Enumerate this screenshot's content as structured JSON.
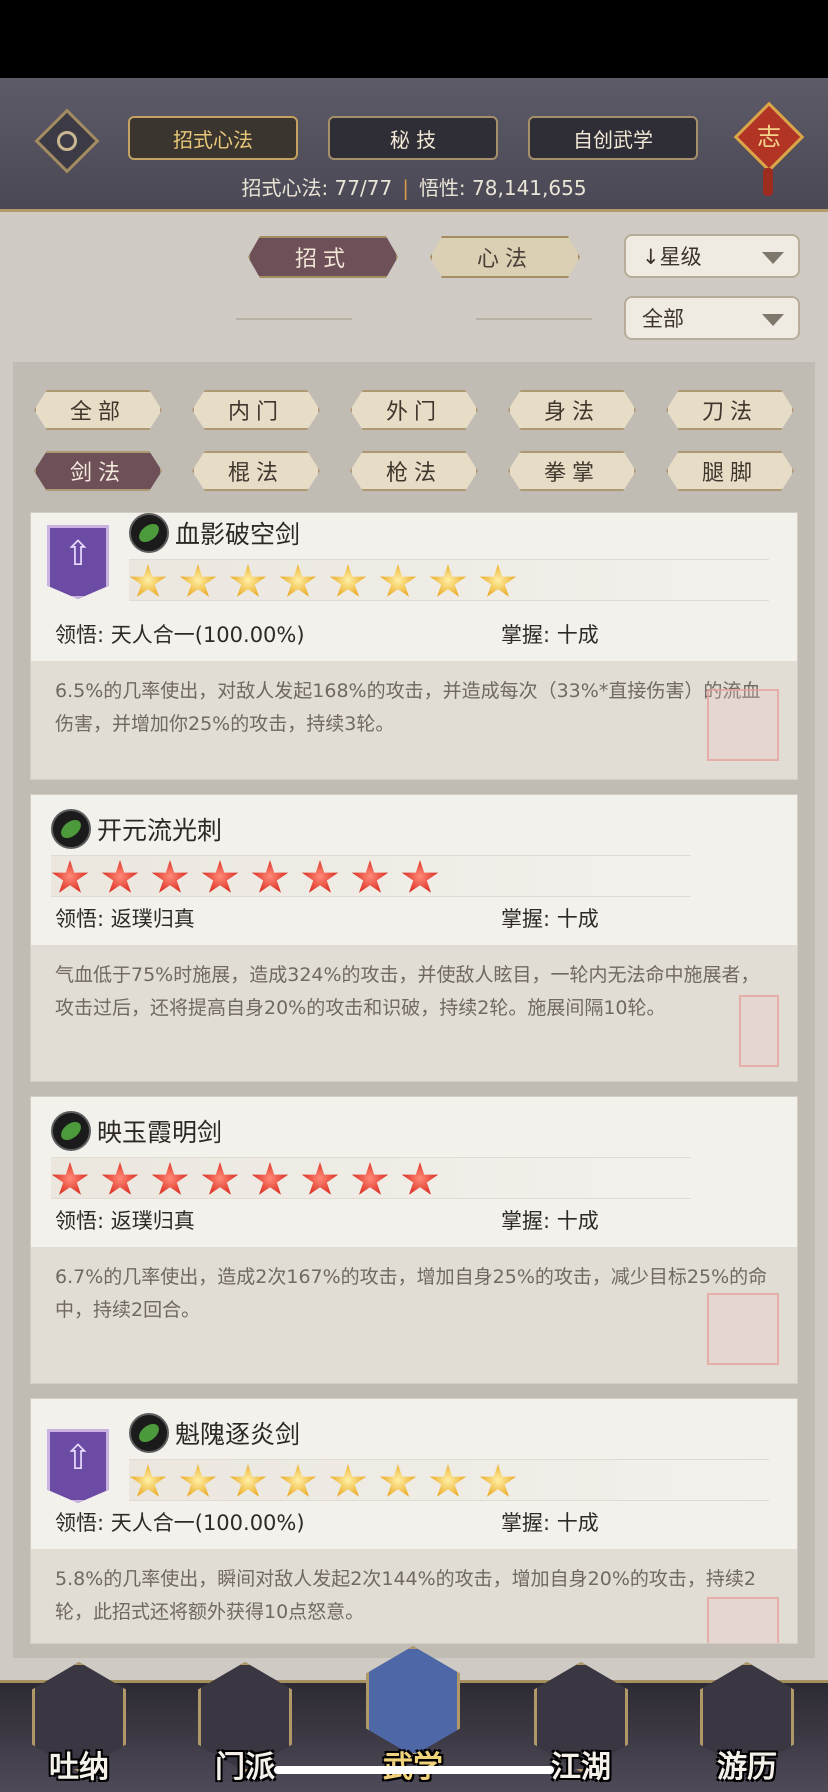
{
  "header": {
    "tabs": [
      {
        "label": "招式心法",
        "active": true
      },
      {
        "label": "秘 技",
        "active": false
      },
      {
        "label": "自创武学",
        "active": false
      }
    ],
    "stats_label_1": "招式心法: 77/77",
    "stats_sep": "|",
    "stats_label_2": "悟性: 78,141,655",
    "zhi_label": "志"
  },
  "segments": [
    {
      "label": "招式",
      "active": true
    },
    {
      "label": "心法",
      "active": false
    }
  ],
  "sort_dropdown": "↓星级",
  "scope_dropdown": "全部",
  "filters_row1": [
    "全部",
    "内门",
    "外门",
    "身法",
    "刀法"
  ],
  "filters_row2": [
    "剑法",
    "棍法",
    "枪法",
    "拳掌",
    "腿脚"
  ],
  "active_filter": "剑法",
  "cards": [
    {
      "title": "血影破空剑",
      "star_color": "gold",
      "stars": 8,
      "upgrade_badge": true,
      "comprehension": "领悟: 天人合一(100.00%)",
      "mastery": "掌握: 十成",
      "description": "6.5%的几率使出，对敌人发起168%的攻击，并造成每次（33%*直接伤害）的流血伤害，并增加你25%的攻击，持续3轮。",
      "seal": "訓練歸真"
    },
    {
      "title": "开元流光刺",
      "star_color": "red",
      "stars": 8,
      "upgrade_badge": false,
      "comprehension": "领悟: 返璞归真",
      "mastery": "掌握: 十成",
      "description": "气血低于75%时施展，造成324%的攻击，并使敌人眩目，一轮内无法命中施展者，攻击过后，还将提高自身20%的攻击和识破，持续2轮。施展间隔10轮。",
      "seal": "絕技"
    },
    {
      "title": "映玉霞明剑",
      "star_color": "red",
      "stars": 8,
      "upgrade_badge": false,
      "comprehension": "领悟: 返璞归真",
      "mastery": "掌握: 十成",
      "description": "6.7%的几率使出，造成2次167%的攻击，增加自身25%的攻击，减少目标25%的命中，持续2回合。",
      "seal": "訓練歸真"
    },
    {
      "title": "魁隗逐炎剑",
      "star_color": "gold",
      "stars": 8,
      "upgrade_badge": true,
      "comprehension": "领悟: 天人合一(100.00%)",
      "mastery": "掌握: 十成",
      "description": "5.8%的几率使出，瞬间对敌人发起2次144%的攻击，增加自身20%的攻击，持续2轮，此招式还将额外获得10点怒意。",
      "seal": "訓練"
    }
  ],
  "nav": [
    {
      "label": "吐纳",
      "icon": "meditation-figure-icon",
      "active": false
    },
    {
      "label": "门派",
      "icon": "sect-banner-icon",
      "active": false
    },
    {
      "label": "武学",
      "icon": "martial-book-icon",
      "active": true
    },
    {
      "label": "江湖",
      "icon": "straw-hat-icon",
      "active": false
    },
    {
      "label": "游历",
      "icon": "horse-icon",
      "active": false
    }
  ]
}
